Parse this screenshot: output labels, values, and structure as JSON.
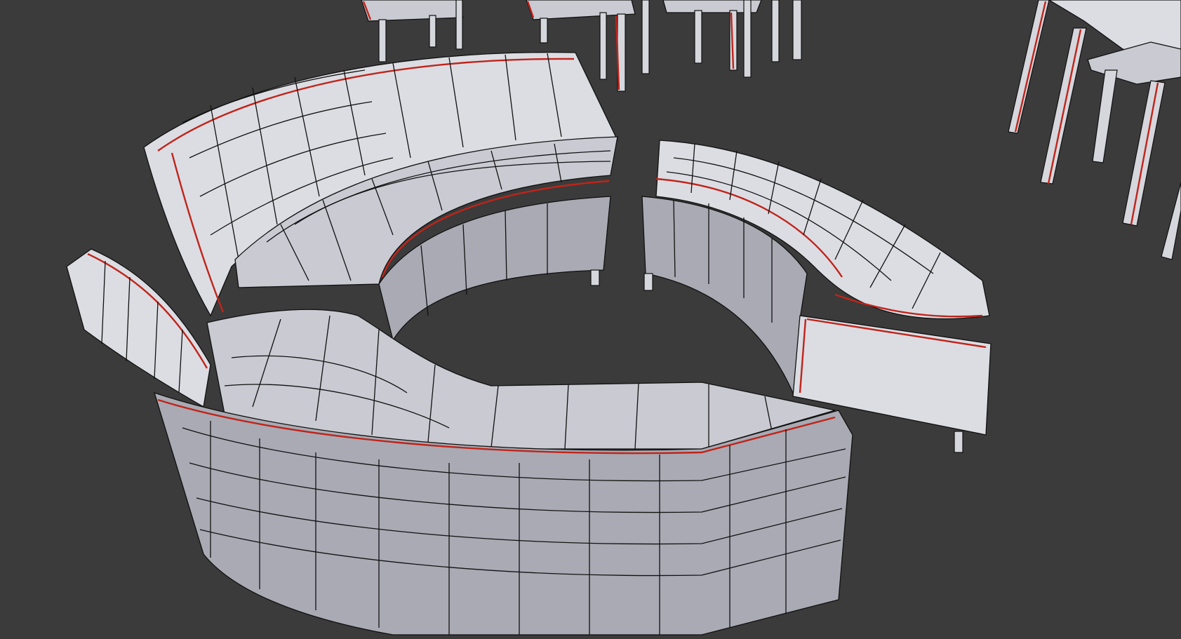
{
  "scene": {
    "background": "#3b3b3b",
    "mesh_color": "#dcdde3",
    "wire_color": "#111111",
    "seam_color": "#c0241a"
  }
}
